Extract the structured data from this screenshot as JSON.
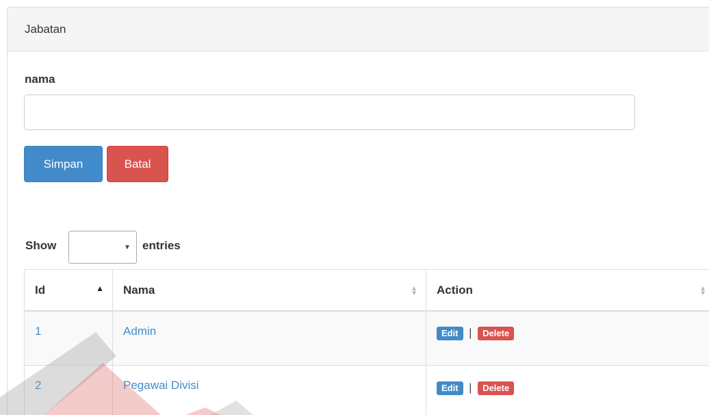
{
  "panel": {
    "title": "Jabatan"
  },
  "form": {
    "label": "nama",
    "input_value": "",
    "save_label": "Simpan",
    "cancel_label": "Batal"
  },
  "table_length": {
    "show_label": "Show",
    "selected": "",
    "entries_label": "entries"
  },
  "table": {
    "headers": [
      "Id",
      "Nama",
      "Action"
    ],
    "rows": [
      {
        "id": "1",
        "nama": "Admin",
        "edit": "Edit",
        "sep": "|",
        "delete": "Delete"
      },
      {
        "id": "2",
        "nama": "Pegawai Divisi",
        "edit": "Edit",
        "sep": "|",
        "delete": "Delete"
      }
    ]
  },
  "colors": {
    "primary": "#428bca",
    "danger": "#d9534f",
    "watermark_red": "#e06a6a",
    "watermark_gray": "#9a9a9a"
  }
}
